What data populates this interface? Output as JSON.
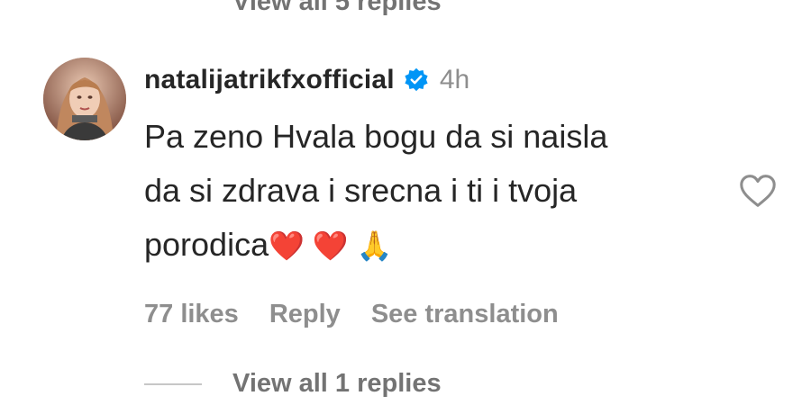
{
  "top": {
    "view_replies_label": "View all 5 replies"
  },
  "comment": {
    "username": "natalijatrikfxofficial",
    "time": "4h",
    "text_lines": [
      "Pa zeno Hvala bogu da si naisla",
      "da si zdrava i srecna i ti i tvoja",
      "porodica"
    ],
    "text_emoji": "❤️ ❤️ 🙏",
    "likes": "77 likes",
    "reply_label": "Reply",
    "translation_label": "See translation",
    "view_replies_label": "View all 1 replies"
  },
  "icons": {
    "verified": "verified-badge-icon",
    "like": "heart-outline-icon"
  },
  "colors": {
    "verified_blue": "#0095f6",
    "secondary_text": "#8e8e8e",
    "primary_text": "#262626"
  }
}
